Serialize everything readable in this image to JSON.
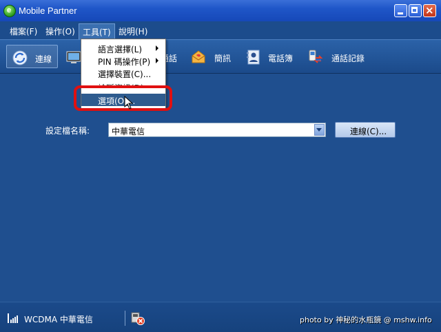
{
  "window": {
    "title": "Mobile Partner"
  },
  "menubar": {
    "items": [
      "檔案(F)",
      "操作(O)",
      "工具(T)",
      "說明(H)"
    ]
  },
  "toolbar": {
    "items": [
      {
        "label": "連線",
        "icon": "connect-icon"
      },
      {
        "label": "通話",
        "icon": "call-icon"
      },
      {
        "label": "簡訊",
        "icon": "sms-icon"
      },
      {
        "label": "電話簿",
        "icon": "phonebook-icon"
      },
      {
        "label": "通話記錄",
        "icon": "call-log-icon"
      }
    ]
  },
  "tools_menu": {
    "items": [
      {
        "label": "語言選擇(L)",
        "submenu": true
      },
      {
        "label": "PIN 碼操作(P)",
        "submenu": true
      },
      {
        "label": "選擇裝置(C)...",
        "submenu": false
      },
      {
        "label": "診斷資訊(D)",
        "submenu": false
      },
      {
        "label": "選項(O)...",
        "submenu": false,
        "highlighted": true
      }
    ]
  },
  "main": {
    "profile_label": "設定檔名稱:",
    "profile_value": "中華電信",
    "connect_button": "連線(C)..."
  },
  "statusbar": {
    "network": "WCDMA  中華電信",
    "watermark": "photo by 神秘的水瓶鏡 @ mshw.info"
  },
  "colors": {
    "window_bg": "#1f4f8f",
    "highlight": "#2e5b8e",
    "annotation_ring": "#e01010"
  }
}
